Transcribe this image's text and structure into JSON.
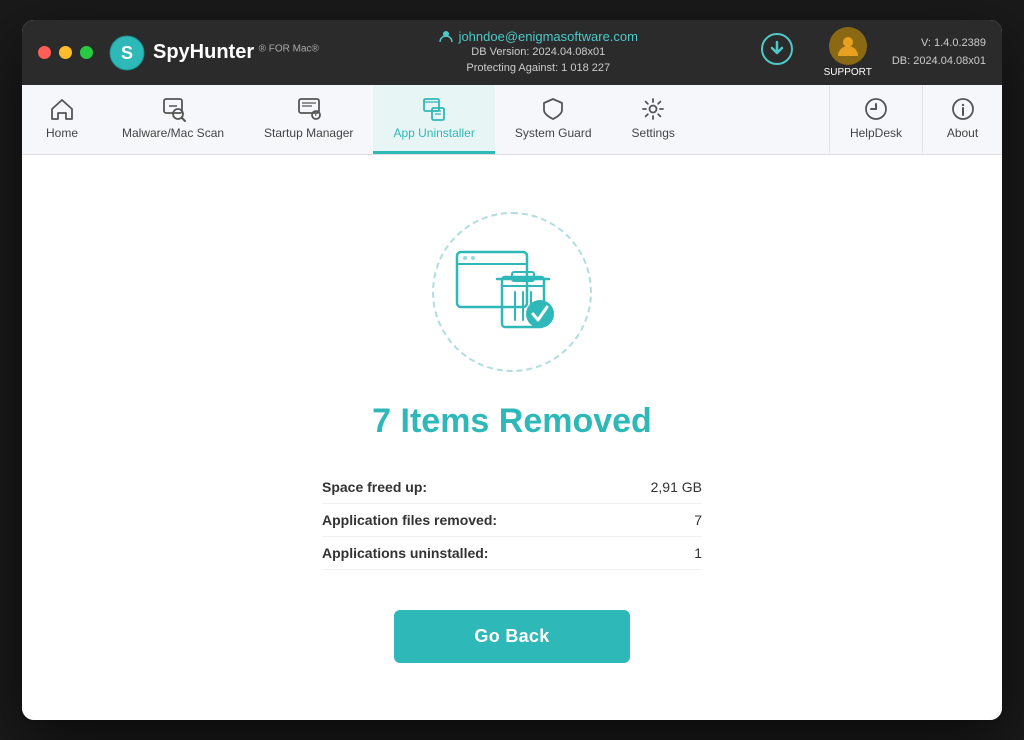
{
  "titlebar": {
    "user_email": "johndoe@enigmasoftware.com",
    "db_version_label": "DB Version: 2024.04.08x01",
    "protecting_label": "Protecting Against: 1 018 227",
    "support_label": "SUPPORT",
    "version_line1": "V: 1.4.0.2389",
    "version_line2": "DB:  2024.04.08x01",
    "logo_text": "SpyHunter",
    "logo_subtext": "FOR Mac"
  },
  "navbar": {
    "items": [
      {
        "id": "home",
        "label": "Home",
        "icon": "🏠",
        "active": false
      },
      {
        "id": "malware-scan",
        "label": "Malware/Mac Scan",
        "icon": "🔍",
        "active": false
      },
      {
        "id": "startup-manager",
        "label": "Startup Manager",
        "icon": "⚙️",
        "active": false
      },
      {
        "id": "app-uninstaller",
        "label": "App Uninstaller",
        "icon": "🗑️",
        "active": true
      },
      {
        "id": "system-guard",
        "label": "System Guard",
        "icon": "🛡️",
        "active": false
      },
      {
        "id": "settings",
        "label": "Settings",
        "icon": "⚙️",
        "active": false
      }
    ],
    "right_items": [
      {
        "id": "helpdesk",
        "label": "HelpDesk",
        "icon": "➕"
      },
      {
        "id": "about",
        "label": "About",
        "icon": "ℹ️"
      }
    ]
  },
  "main": {
    "result_heading": "7 Items Removed",
    "stats": [
      {
        "label": "Space freed up:",
        "value": "2,91 GB"
      },
      {
        "label": "Application files removed:",
        "value": "7"
      },
      {
        "label": "Applications uninstalled:",
        "value": "1"
      }
    ],
    "go_back_label": "Go Back"
  }
}
